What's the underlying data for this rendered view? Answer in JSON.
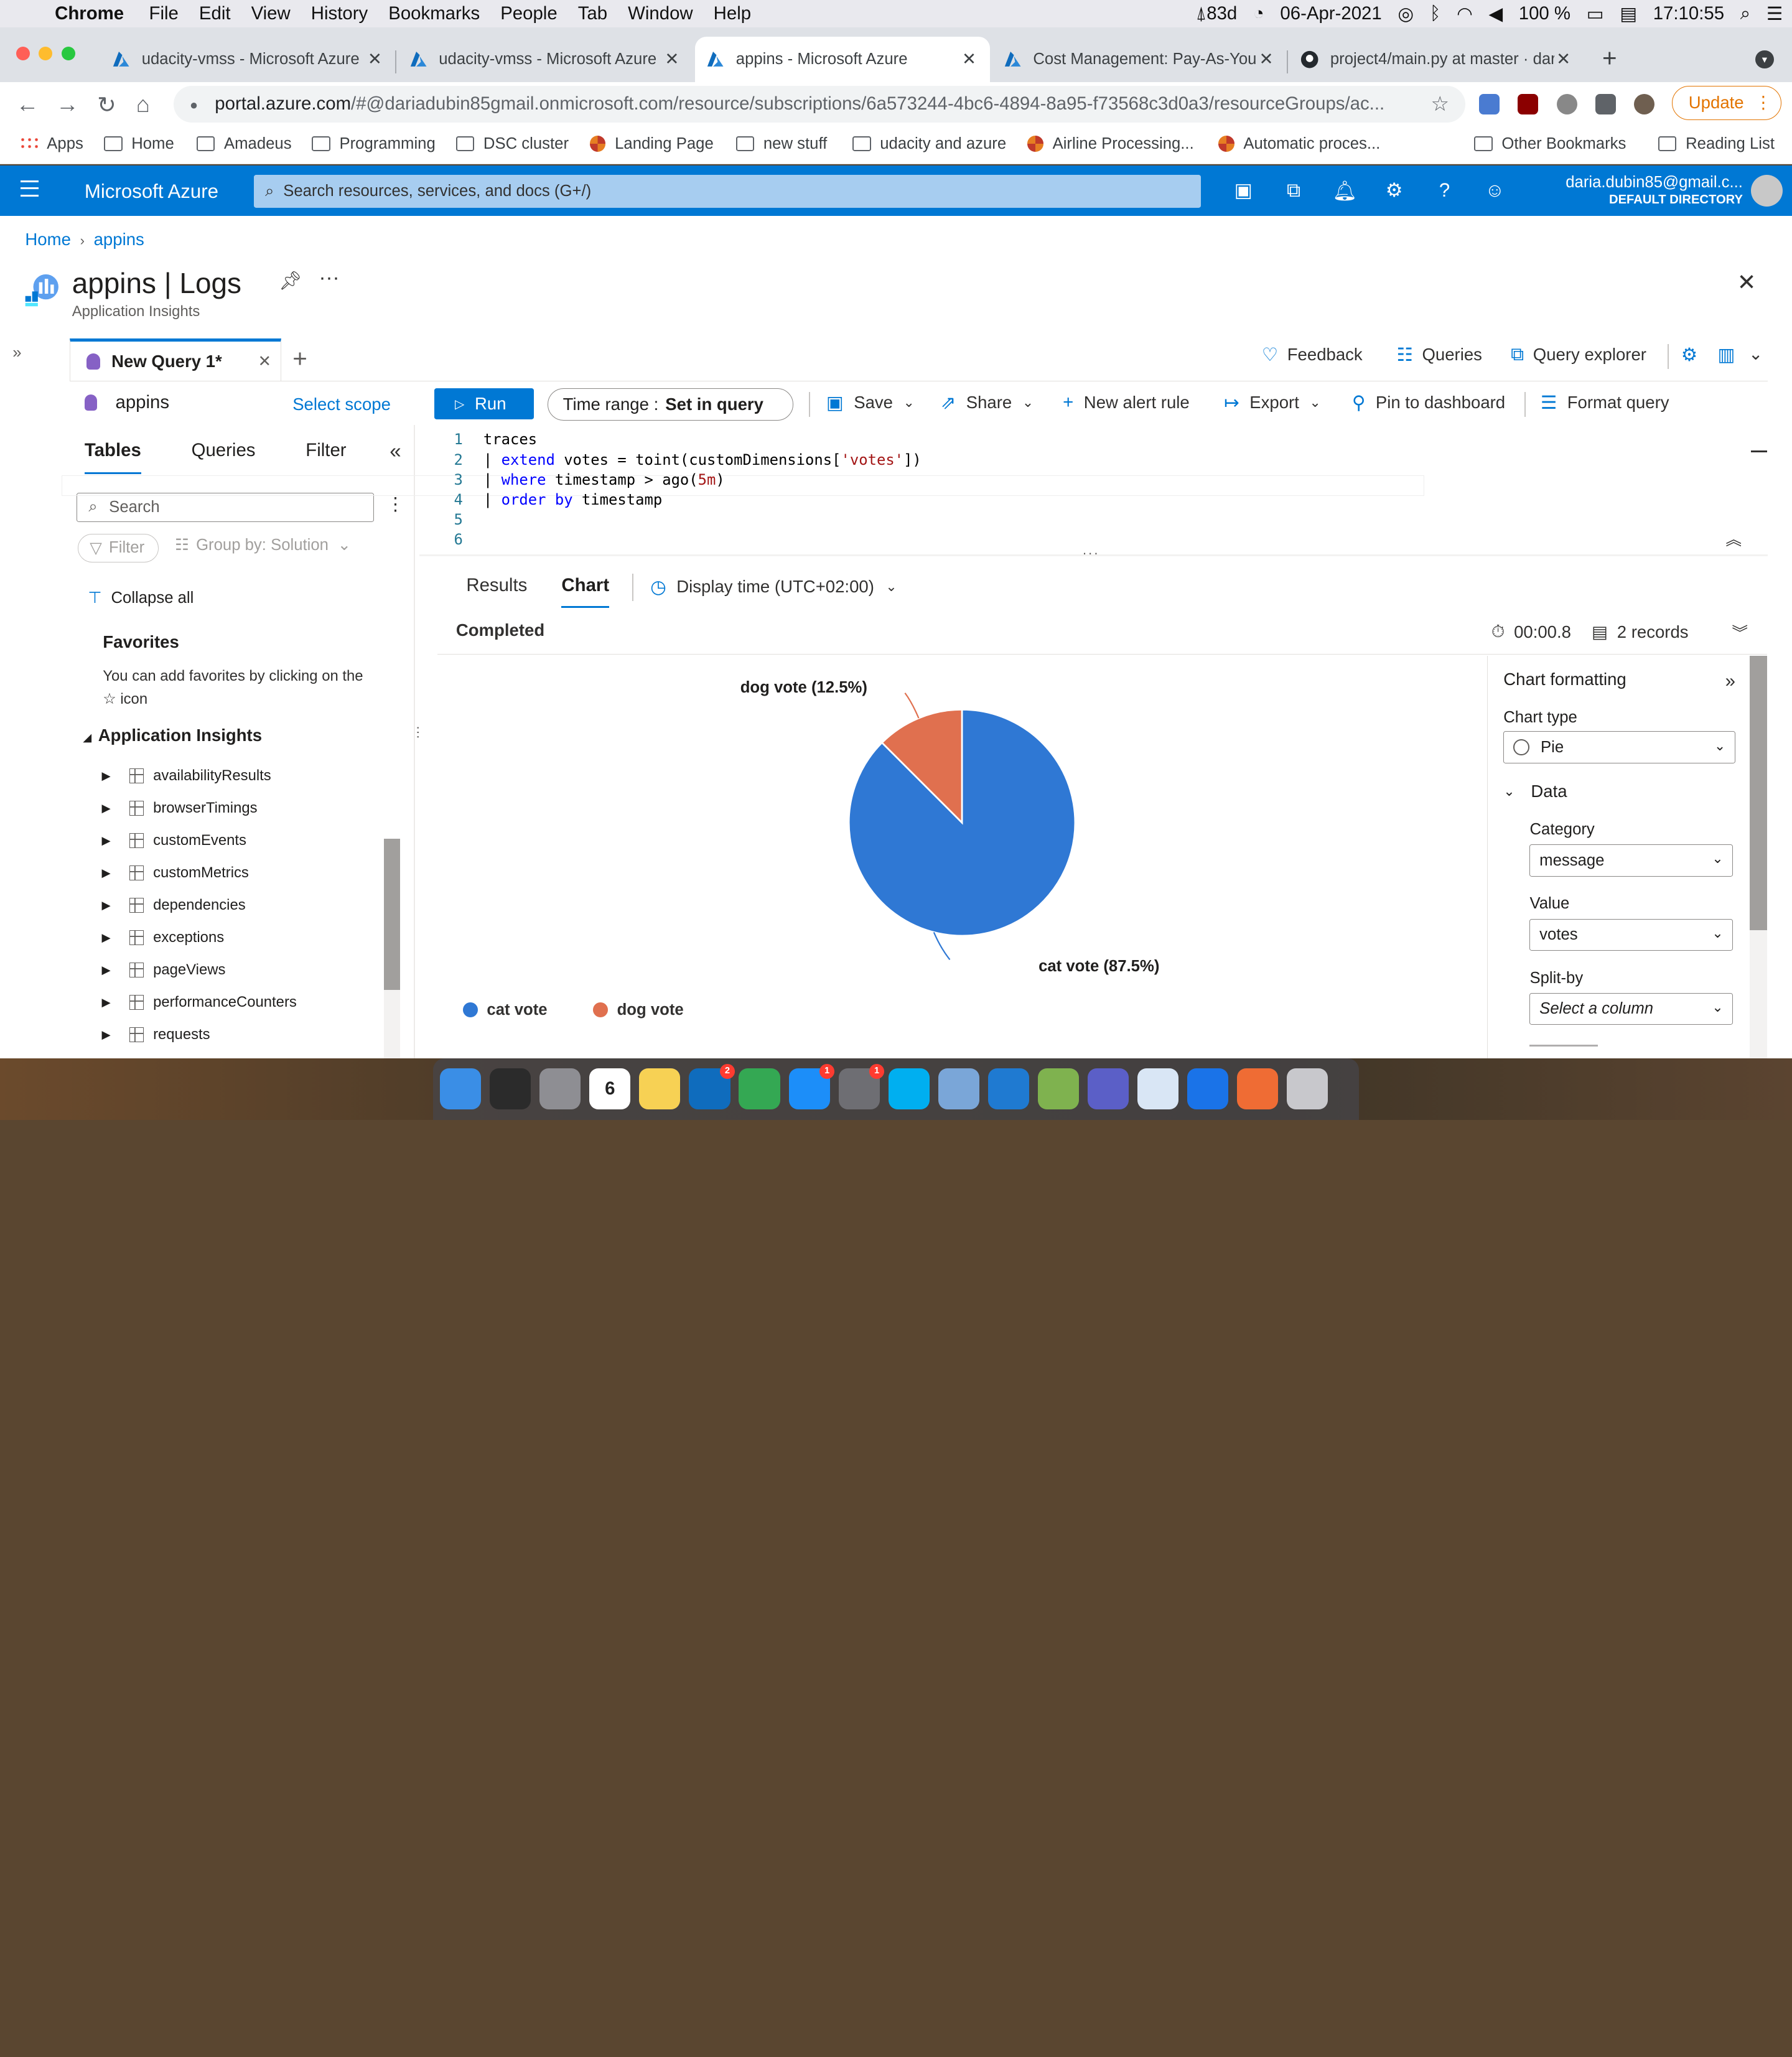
{
  "menubar": {
    "app": "Chrome",
    "items": [
      "File",
      "Edit",
      "View",
      "History",
      "Bookmarks",
      "People",
      "Tab",
      "Window",
      "Help"
    ],
    "status_days": "83d",
    "date": "06-Apr-2021",
    "battery": "100 %",
    "time": "17:10:55"
  },
  "tabs": [
    {
      "title": "udacity-vmss - Microsoft Azure",
      "active": false
    },
    {
      "title": "udacity-vmss - Microsoft Azure",
      "active": false
    },
    {
      "title": "appins - Microsoft Azure",
      "active": true
    },
    {
      "title": "Cost Management: Pay-As-You",
      "active": false
    },
    {
      "title": "project4/main.py at master · dar",
      "active": false
    }
  ],
  "address": {
    "host": "portal.azure.com",
    "path": "/#@dariadubin85gmail.onmicrosoft.com/resource/subscriptions/6a573244-4bc6-4894-8a95-f73568c3d0a3/resourceGroups/ac...",
    "update_label": "Update"
  },
  "bookmarks": {
    "items": [
      {
        "label": "Apps",
        "icon": "apps-grid-icon"
      },
      {
        "label": "Home",
        "icon": "folder-icon"
      },
      {
        "label": "Amadeus",
        "icon": "folder-icon"
      },
      {
        "label": "Programming",
        "icon": "folder-icon"
      },
      {
        "label": "DSC cluster",
        "icon": "folder-icon"
      },
      {
        "label": "Landing Page",
        "icon": "tableau-icon"
      },
      {
        "label": "new stuff",
        "icon": "folder-icon"
      },
      {
        "label": "udacity and azure",
        "icon": "folder-icon"
      },
      {
        "label": "Airline Processing...",
        "icon": "tableau-icon"
      },
      {
        "label": "Automatic proces...",
        "icon": "tableau-icon"
      }
    ],
    "other": "Other Bookmarks",
    "reading_list": "Reading List"
  },
  "azure": {
    "brand": "Microsoft Azure",
    "search_placeholder": "Search resources, services, and docs (G+/)",
    "user_email": "daria.dubin85@gmail.c...",
    "directory": "DEFAULT DIRECTORY"
  },
  "breadcrumb": {
    "home": "Home",
    "current": "appins"
  },
  "blade": {
    "title": "appins | Logs",
    "subtitle": "Application Insights"
  },
  "query_tab": {
    "label": "New Query 1*"
  },
  "top_actions": {
    "feedback": "Feedback",
    "queries": "Queries",
    "query_explorer": "Query explorer"
  },
  "command": {
    "scope_name": "appins",
    "select_scope": "Select scope",
    "run": "Run",
    "time_range_label": "Time range :",
    "time_range_value": "Set in query",
    "save": "Save",
    "share": "Share",
    "new_alert": "New alert rule",
    "export": "Export",
    "pin": "Pin to dashboard",
    "format": "Format query"
  },
  "schema": {
    "tabs": [
      "Tables",
      "Queries",
      "Filter"
    ],
    "search_placeholder": "Search",
    "filter": "Filter",
    "group_by": "Group by: Solution",
    "collapse_all": "Collapse all",
    "favorites_title": "Favorites",
    "favorites_text": "You can add favorites by clicking on the ☆ icon",
    "section": "Application Insights",
    "tables": [
      "availabilityResults",
      "browserTimings",
      "customEvents",
      "customMetrics",
      "dependencies",
      "exceptions",
      "pageViews",
      "performanceCounters",
      "requests"
    ]
  },
  "editor": {
    "line_numbers": [
      "1",
      "2",
      "3",
      "4",
      "5",
      "6"
    ]
  },
  "results": {
    "tabs": [
      "Results",
      "Chart"
    ],
    "display_time": "Display time (UTC+02:00)",
    "status": "Completed",
    "duration": "00:00.8",
    "records": "2 records"
  },
  "chart_data": {
    "type": "pie",
    "categories": [
      "cat vote",
      "dog vote"
    ],
    "values": [
      87.5,
      12.5
    ],
    "colors": [
      "#2f78d4",
      "#e0704f"
    ],
    "labels": [
      "cat vote (87.5%)",
      "dog vote (12.5%)"
    ],
    "legend_position": "bottom-left"
  },
  "formatting": {
    "title": "Chart formatting",
    "chart_type_label": "Chart type",
    "chart_type": "Pie",
    "data_section": "Data",
    "category_label": "Category",
    "category": "message",
    "value_label": "Value",
    "value": "votes",
    "split_label": "Split-by",
    "split_placeholder": "Select a column"
  },
  "dock": {
    "apps": [
      {
        "name": "finder-icon",
        "color": "#3a8ee6"
      },
      {
        "name": "terminal-icon",
        "color": "#2b2b2b"
      },
      {
        "name": "launchpad-icon",
        "color": "#8e8e93"
      },
      {
        "name": "calendar-icon",
        "color": "#ffffff",
        "text": "6"
      },
      {
        "name": "notes-icon",
        "color": "#f7d154"
      },
      {
        "name": "outlook-icon",
        "color": "#0f6cbd",
        "badge": "2"
      },
      {
        "name": "chrome-icon",
        "color": "#34a853"
      },
      {
        "name": "app-store-icon",
        "color": "#1c8ef9",
        "badge": "1"
      },
      {
        "name": "system-preferences-icon",
        "color": "#6e6e73",
        "badge": "1"
      },
      {
        "name": "skype-icon",
        "color": "#00aff0"
      },
      {
        "name": "preview-icon",
        "color": "#7aa6d8"
      },
      {
        "name": "vscode-icon",
        "color": "#1f7ad1"
      },
      {
        "name": "keychain-icon",
        "color": "#7fb24f"
      },
      {
        "name": "teams-icon",
        "color": "#5b5fc7"
      },
      {
        "name": "tableau-icon",
        "color": "#d9e6f5"
      },
      {
        "name": "maps-pin-icon",
        "color": "#1a73e8"
      },
      {
        "name": "postman-icon",
        "color": "#ef6c34"
      },
      {
        "name": "trash-icon",
        "color": "#c8c8cc"
      }
    ]
  }
}
